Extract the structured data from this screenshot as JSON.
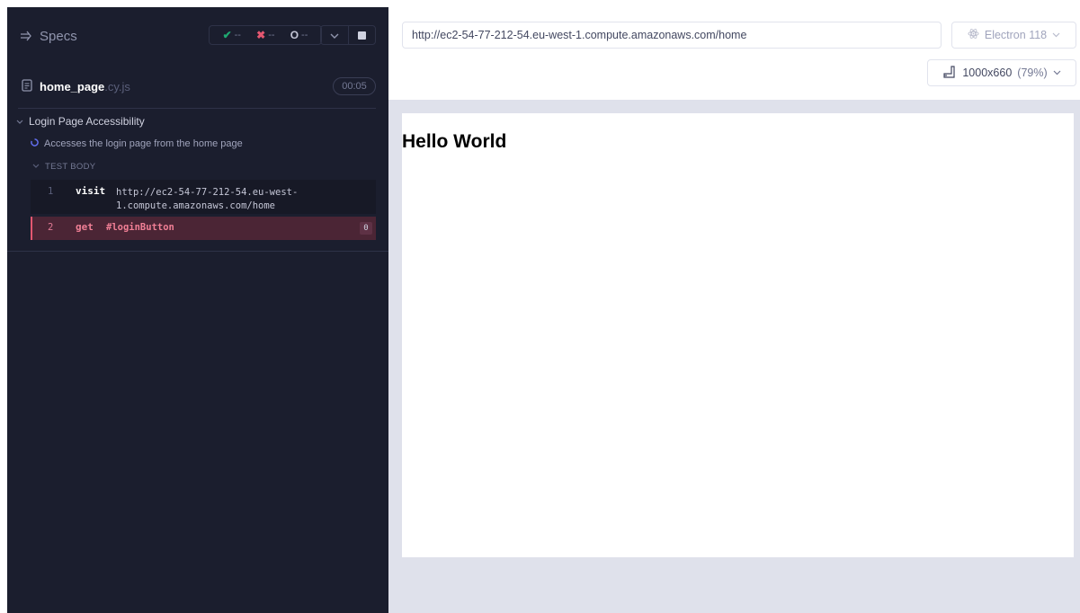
{
  "reporter": {
    "specs_label": "Specs",
    "stats": {
      "passed": {
        "glyph": "✔",
        "value": "--"
      },
      "failed": {
        "glyph": "✖",
        "value": "--"
      },
      "pending": {
        "glyph": "O",
        "value": "--"
      }
    },
    "spec": {
      "name": "home_page",
      "ext": ".cy.js",
      "duration": "00:05"
    },
    "suite": {
      "title": "Login Page Accessibility"
    },
    "test": {
      "title": "Accesses the login page from the home page"
    },
    "test_body_label": "TEST BODY",
    "commands": [
      {
        "number": "1",
        "name": "visit",
        "message": "http://ec2-54-77-212-54.eu-west-1.compute.amazonaws.com/home"
      },
      {
        "number": "2",
        "name": "get",
        "message": "#loginButton",
        "count": "0"
      }
    ]
  },
  "aut": {
    "url": "http://ec2-54-77-212-54.eu-west-1.compute.amazonaws.com/home",
    "browser": {
      "label": "Electron 118",
      "icon": "electron-icon"
    },
    "viewport": {
      "size": "1000x660",
      "scale": "(79%)",
      "icon": "viewport-icon"
    },
    "page_heading": "Hello World"
  },
  "colors": {
    "reporter_bg": "#1b1e2e",
    "passed": "#1fa971",
    "failed": "#e45770",
    "failed_row_bg": "#4b2535",
    "stage_bg": "#dfe1eb"
  }
}
